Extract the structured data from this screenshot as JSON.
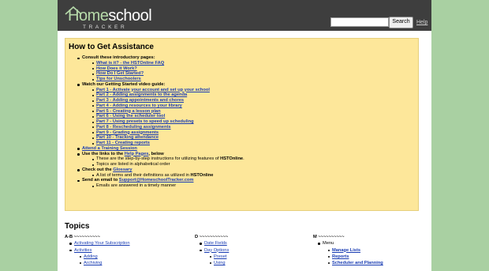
{
  "header": {
    "logo_home": "Home",
    "logo_school": "school",
    "logo_tracker": "TRACKER",
    "search_value": "",
    "search_button": "Search",
    "help": "Help"
  },
  "assist": {
    "title": "How to Get Assistance",
    "consult": {
      "label": "Consult these introductory pages:",
      "links": [
        "What is it? - the HSTOnline FAQ",
        "How Does it Work?",
        "How Do I Get Started?",
        "Tips for Unschoolers"
      ]
    },
    "watch": {
      "label": "Watch our Getting Started video guide:",
      "parts": [
        "Part 1 - Activate your account and set up your school",
        "Part 2 - Adding assignments to the agenda",
        "Part 3 - Adding appointments and chores",
        "Part 4 - Adding resources to your library",
        "Part 5 - Creating a lesson plan",
        "Part 6 - Using the scheduler tool",
        "Part 7 - Using presets to speed up scheduling",
        "Part 8 - Rescheduling assignments",
        "Part 9 - Grading assignments",
        "Part 10 - Tracking attendance",
        "Part 11 - Creating reports"
      ]
    },
    "attend": "Attend a Training Session",
    "help_pages": {
      "prefix": "Use the links to the ",
      "link": "Help Pages",
      "suffix": ", below",
      "sub1": "These are the step-by-step instructions for utilizing features of ",
      "sub1_bold": "HSTOnline",
      "sub1_end": ".",
      "sub2": "Topics are listed in alphabetical order"
    },
    "glossary": {
      "prefix": "Check out the ",
      "link": "Glossary",
      "sub_prefix": "A list of terms and their definitions as utilized in ",
      "sub_bold": "HSTOnline"
    },
    "email": {
      "prefix": "Send an email to ",
      "link": "Support@HomeschoolTracker.com",
      "sub": "Emails are answered in a timely manner"
    }
  },
  "topics": {
    "title": "Topics",
    "col1": {
      "head": "A-B ~~~~~~~~~~",
      "items": [
        "Activating Your Subscription",
        "Activities"
      ],
      "subitems": [
        "Adding",
        "Archiving"
      ]
    },
    "col2": {
      "head": "D ~~~~~~~~~~~",
      "items": [
        "Date Fields",
        "Day Options"
      ],
      "subitems": [
        "Preset",
        "Using"
      ]
    },
    "col3": {
      "head": "M ~~~~~~~~~~",
      "items": [
        "Menu"
      ],
      "subitems": [
        "Manage Lists",
        "Reports",
        "Scheduler and Planning"
      ]
    }
  },
  "colors": {
    "background": "#a9d0a2",
    "header": "#3e3e3e",
    "panel": "#fde79a",
    "link": "#1a3db3"
  }
}
